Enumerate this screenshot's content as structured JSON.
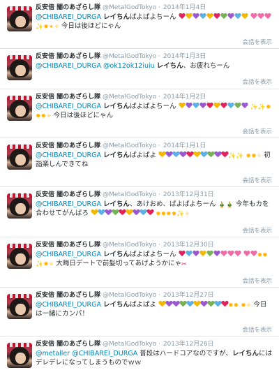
{
  "expand_label": "会話を表示",
  "colors": {
    "link": "#0084b4",
    "meta": "#8899a6",
    "text": "#292f33",
    "divider": "#e1e8ed"
  },
  "tweets": [
    {
      "name": "反安倍 闇のあざらし隊",
      "handle": "@MetalGodTokyo",
      "date": "2014年1月4日",
      "mention": "@CHIBAREI_DURGA",
      "bold": "レイちん",
      "body_a": "ぱよぱよちーん",
      "body_b": "今日は後ほどにゃん"
    },
    {
      "name": "反安倍 闇のあざらし隊",
      "handle": "@MetalGodTokyo",
      "date": "2014年1月3日",
      "mention": "@CHIBAREI_DURGA",
      "mention2": "@ok12ok12iuiu",
      "bold": "レイちん",
      "body_a": "、お疲れちーん"
    },
    {
      "name": "反安倍 闇のあざらし隊",
      "handle": "@MetalGodTokyo",
      "date": "2014年1月2日",
      "mention": "@CHIBAREI_DURGA",
      "bold": "レイちん",
      "body_a": "ぱよぱよちーん",
      "body_b": "今日は後ほどにゃん"
    },
    {
      "name": "反安倍 闇のあざらし隊",
      "handle": "@MetalGodTokyo",
      "date": "2014年1月1日",
      "mention": "@CHIBAREI_DURGA",
      "bold": "レイちん",
      "body_a": "ぱよぱよ",
      "body_b": "初詣楽しんできてね"
    },
    {
      "name": "反安倍 闇のあざらし隊",
      "handle": "@MetalGodTokyo",
      "date": "2013年12月31日",
      "mention": "@CHIBAREI_DURGA",
      "bold": "レイちん",
      "body_a": "、あけおめ、ぱよぱよちーん",
      "body_b": "今年もカを合わせてがんばろ"
    },
    {
      "name": "反安倍 闇のあざらし隊",
      "handle": "@MetalGodTokyo",
      "date": "2013年12月30日",
      "mention": "@CHIBAREI_DURGA",
      "bold": "レイちん",
      "body_a": "ぱよぱよちーん",
      "body_b": "大晦日デートで前髪切ってあげようかにゃ"
    },
    {
      "name": "反安倍 闇のあざらし隊",
      "handle": "@MetalGodTokyo",
      "date": "2013年12月27日",
      "mention": "@CHIBAREI_DURGA",
      "bold": "レイちん",
      "body_a": "ぱよぱよ",
      "body_b": "今日は一緒にカンパ！"
    },
    {
      "name": "反安倍 闇のあざらし隊",
      "handle": "@MetalGodTokyo",
      "date": "2013年12月26日",
      "mention": "@metaller",
      "mention2": "@CHIBAREI_DURGA",
      "body_a": "普段はハードコアなのですが、",
      "bold": "レイちん",
      "body_b": "にはデレデレになってしまうものでｗｗ"
    }
  ]
}
